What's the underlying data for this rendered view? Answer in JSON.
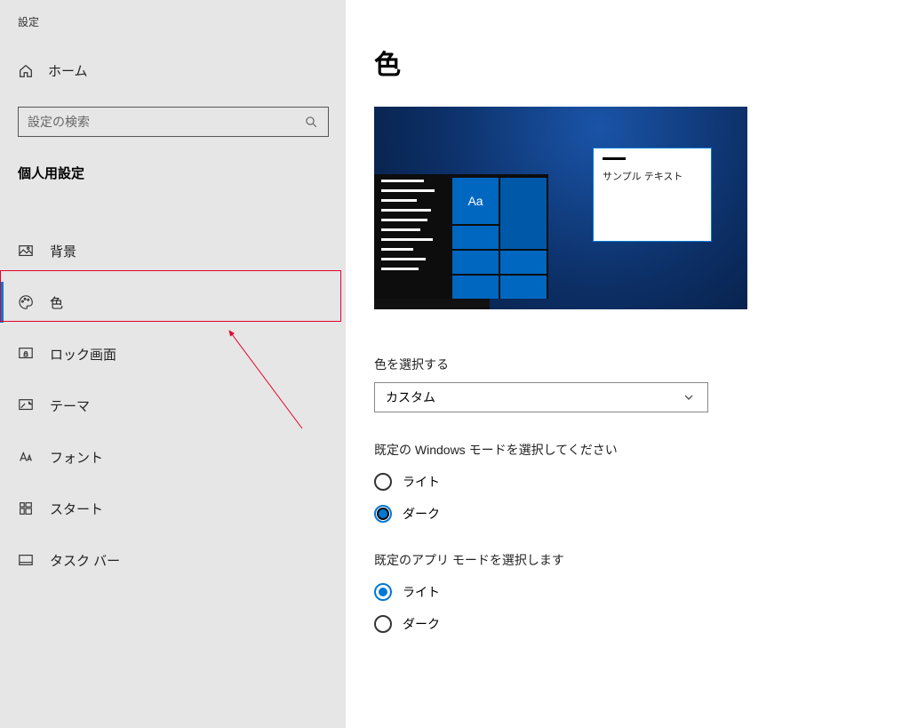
{
  "window_title": "設定",
  "home_label": "ホーム",
  "search_placeholder": "設定の検索",
  "category_header": "個人用設定",
  "nav": {
    "background": "背景",
    "colors": "色",
    "lockscreen": "ロック画面",
    "themes": "テーマ",
    "fonts": "フォント",
    "start": "スタート",
    "taskbar": "タスク バー"
  },
  "page_title": "色",
  "preview": {
    "sample_text": "サンプル テキスト",
    "tile_label": "Aa"
  },
  "choose_color": {
    "label": "色を選択する",
    "value": "カスタム"
  },
  "windows_mode": {
    "label": "既定の Windows モードを選択してください",
    "light": "ライト",
    "dark": "ダーク",
    "selected": "dark"
  },
  "app_mode": {
    "label": "既定のアプリ モードを選択します",
    "light": "ライト",
    "dark": "ダーク",
    "selected": "light"
  }
}
